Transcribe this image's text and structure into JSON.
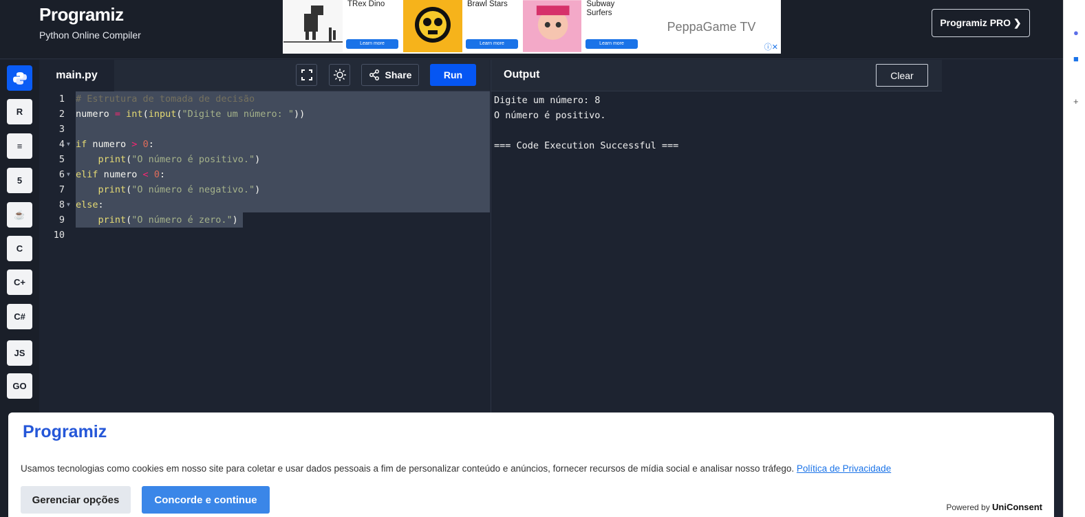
{
  "header": {
    "brand": "Programiz",
    "subtitle": "Python Online Compiler",
    "pro_button": "Programiz PRO ❯"
  },
  "ads": [
    {
      "title": "TRex Dino",
      "learn": "Learn more"
    },
    {
      "title": "Brawl Stars",
      "learn": "Learn more"
    },
    {
      "title": "Subway Surfers",
      "learn": "Learn more"
    },
    {
      "title": "PeppaGame TV"
    }
  ],
  "sidebar": {
    "items": [
      {
        "label": "🐍",
        "name": "python"
      },
      {
        "label": "R",
        "name": "r"
      },
      {
        "label": "≡",
        "name": "sql"
      },
      {
        "label": "5",
        "name": "html"
      },
      {
        "label": "☕",
        "name": "java"
      },
      {
        "label": "C",
        "name": "c"
      },
      {
        "label": "C+",
        "name": "cpp"
      },
      {
        "label": "C#",
        "name": "csharp"
      },
      {
        "label": "JS",
        "name": "javascript"
      },
      {
        "label": "GO",
        "name": "go"
      }
    ]
  },
  "editor": {
    "tab": "main.py",
    "share_label": "Share",
    "run_label": "Run",
    "lines": [
      "1",
      "2",
      "3",
      "4",
      "5",
      "6",
      "7",
      "8",
      "9",
      "10"
    ]
  },
  "code": {
    "l1": "# Estrutura de tomada de decisão",
    "l2_var": "numero ",
    "l2_eq": "= ",
    "l2_int": "int",
    "l2_p1": "(",
    "l2_input": "input",
    "l2_p2": "(",
    "l2_str": "\"Digite um número: \"",
    "l2_p3": "))",
    "l4_kw": "if",
    "l4_rest": " numero ",
    "l4_op": ">",
    "l4_num": " 0",
    "l4_colon": ":",
    "l5_ind": "    ",
    "l5_fn": "print",
    "l5_p": "(",
    "l5_str": "\"O número é positivo.\"",
    "l5_pe": ")",
    "l6_kw": "elif",
    "l6_rest": " numero ",
    "l6_op": "<",
    "l6_num": " 0",
    "l6_colon": ":",
    "l7_ind": "    ",
    "l7_fn": "print",
    "l7_p": "(",
    "l7_str": "\"O número é negativo.\"",
    "l7_pe": ")",
    "l8_kw": "else",
    "l8_colon": ":",
    "l9_ind": "    ",
    "l9_fn": "print",
    "l9_p": "(",
    "l9_str": "\"O número é zero.\"",
    "l9_pe": ")"
  },
  "output": {
    "title": "Output",
    "clear_label": "Clear",
    "lines": [
      "Digite um número: 8",
      "O número é positivo.",
      "",
      "=== Code Execution Successful ==="
    ]
  },
  "cookie": {
    "logo": "Programiz",
    "text": "Usamos tecnologias como cookies em nosso site para coletar e usar dados pessoais a fim de personalizar conteúdo e anúncios, fornecer recursos de mídia social e analisar nosso tráfego.",
    "privacy_link": "Política de Privacidade",
    "manage_label": "Gerenciar opções",
    "accept_label": "Concorde e continue",
    "powered_prefix": "Powered by",
    "powered_brand": "UniConsent"
  },
  "colors": {
    "accent": "#0556f3",
    "background": "#1d2330"
  }
}
